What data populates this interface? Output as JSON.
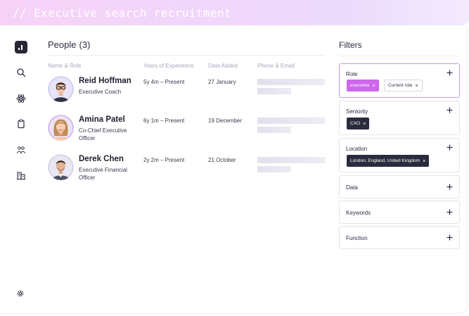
{
  "banner": {
    "title": "// Executive search recruitment"
  },
  "people": {
    "title": "People",
    "count": "(3)",
    "columns": {
      "name_role": "Name & Role",
      "experience": "Years of Experience",
      "added": "Data Added",
      "contact": "Phone & Email"
    },
    "rows": [
      {
        "name": "Reid Hoffman",
        "role": "Executive Coach",
        "experience": "5y 4m – Present",
        "added": "27 January"
      },
      {
        "name": "Amina Patel",
        "role": "Co-Chief Executive Officer",
        "experience": "6y 1m – Present",
        "added": "19 December"
      },
      {
        "name": "Derek Chen",
        "role": "Executive Financial Officer",
        "experience": "2y 2m – Present",
        "added": "21 October"
      }
    ]
  },
  "filters": {
    "title": "Filters",
    "role": {
      "label": "Role",
      "chips": [
        "executive",
        "Current role"
      ]
    },
    "seniority": {
      "label": "Seniority",
      "chips": [
        "CXO"
      ]
    },
    "location": {
      "label": "Location",
      "chips": [
        "London, England, United Kingdom"
      ]
    },
    "data": {
      "label": "Data"
    },
    "keywords": {
      "label": "Keywords"
    },
    "function": {
      "label": "Function"
    }
  },
  "icons": {
    "rail": [
      "analytics-icon",
      "search-icon",
      "atom-icon",
      "clipboard-icon",
      "people-icon",
      "buildings-icon"
    ],
    "settings": "gear-icon"
  },
  "colors": {
    "accent": "#cd67ec",
    "dark": "#2a2b3d",
    "banner": "#f1d6fb"
  }
}
